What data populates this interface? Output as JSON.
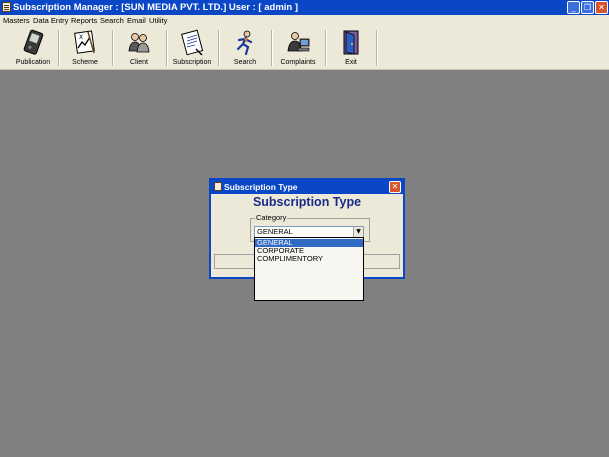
{
  "window": {
    "title": "Subscription Manager : [SUN MEDIA PVT. LTD.] User : [ admin ]",
    "controls": [
      "minimize",
      "maximize",
      "close"
    ]
  },
  "menubar": {
    "items": [
      "Masters",
      "Data Entry",
      "Reports",
      "Search",
      "Email",
      "Utility"
    ]
  },
  "toolbar": {
    "buttons": [
      {
        "label": "Publication",
        "icon": "device-icon"
      },
      {
        "label": "Scheme",
        "icon": "chart-icon"
      },
      {
        "label": "Client",
        "icon": "people-icon"
      },
      {
        "label": "Subscription",
        "icon": "notepad-icon"
      },
      {
        "label": "Search",
        "icon": "runner-icon"
      },
      {
        "label": "Complaints",
        "icon": "operator-icon"
      },
      {
        "label": "Exit",
        "icon": "door-icon"
      }
    ]
  },
  "dialog": {
    "title": "Subscription Type",
    "heading": "Subscription Type",
    "group_label": "Category",
    "combo_value": "GENERAL",
    "options": [
      "GENERAL",
      "CORPORATE",
      "COMPLIMENTORY"
    ],
    "selected_option": "GENERAL"
  },
  "colors": {
    "desktop": "#808080",
    "titlebar": "#0a47c7",
    "chrome": "#ece9d8",
    "heading": "#1a2a8a",
    "selection": "#316ac5"
  }
}
